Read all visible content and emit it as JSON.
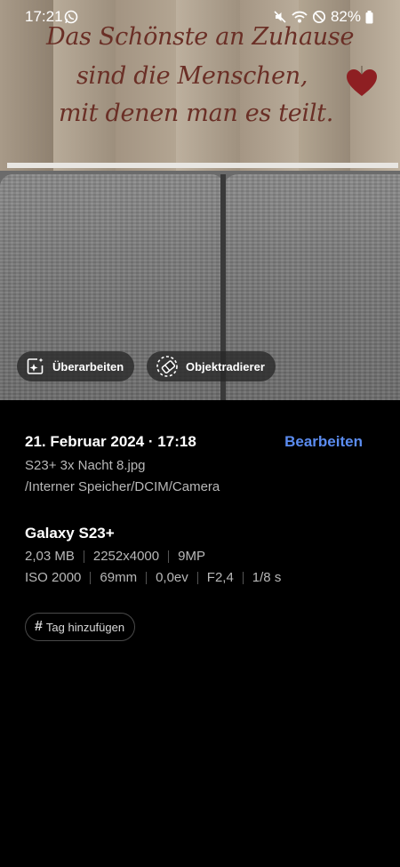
{
  "status_bar": {
    "time": "17:21",
    "notification_icon": "whatsapp-icon",
    "icons": [
      "mute-icon",
      "wifi-icon",
      "do-not-disturb-icon",
      "battery-icon"
    ],
    "battery_percent": "82%"
  },
  "photo": {
    "sign_lines": [
      "Das Schönste an Zuhause",
      "sind die Menschen,",
      "mit denen man es teilt."
    ]
  },
  "photo_actions": {
    "remaster_label": "Überarbeiten",
    "object_eraser_label": "Objektradierer"
  },
  "details": {
    "date_time": "21. Februar 2024 · 17:18",
    "edit_label": "Bearbeiten",
    "edit_color": "#5b8cf0",
    "filename": "S23+ 3x Nacht 8.jpg",
    "path": "/Interner Speicher/DCIM/Camera",
    "device": "Galaxy S23+",
    "specs_row1": [
      "2,03 MB",
      "2252x4000",
      "9MP"
    ],
    "specs_row2": [
      "ISO 2000",
      "69mm",
      "0,0ev",
      "F2,4",
      "1/8 s"
    ],
    "add_tag_label": "Tag hinzufügen"
  }
}
